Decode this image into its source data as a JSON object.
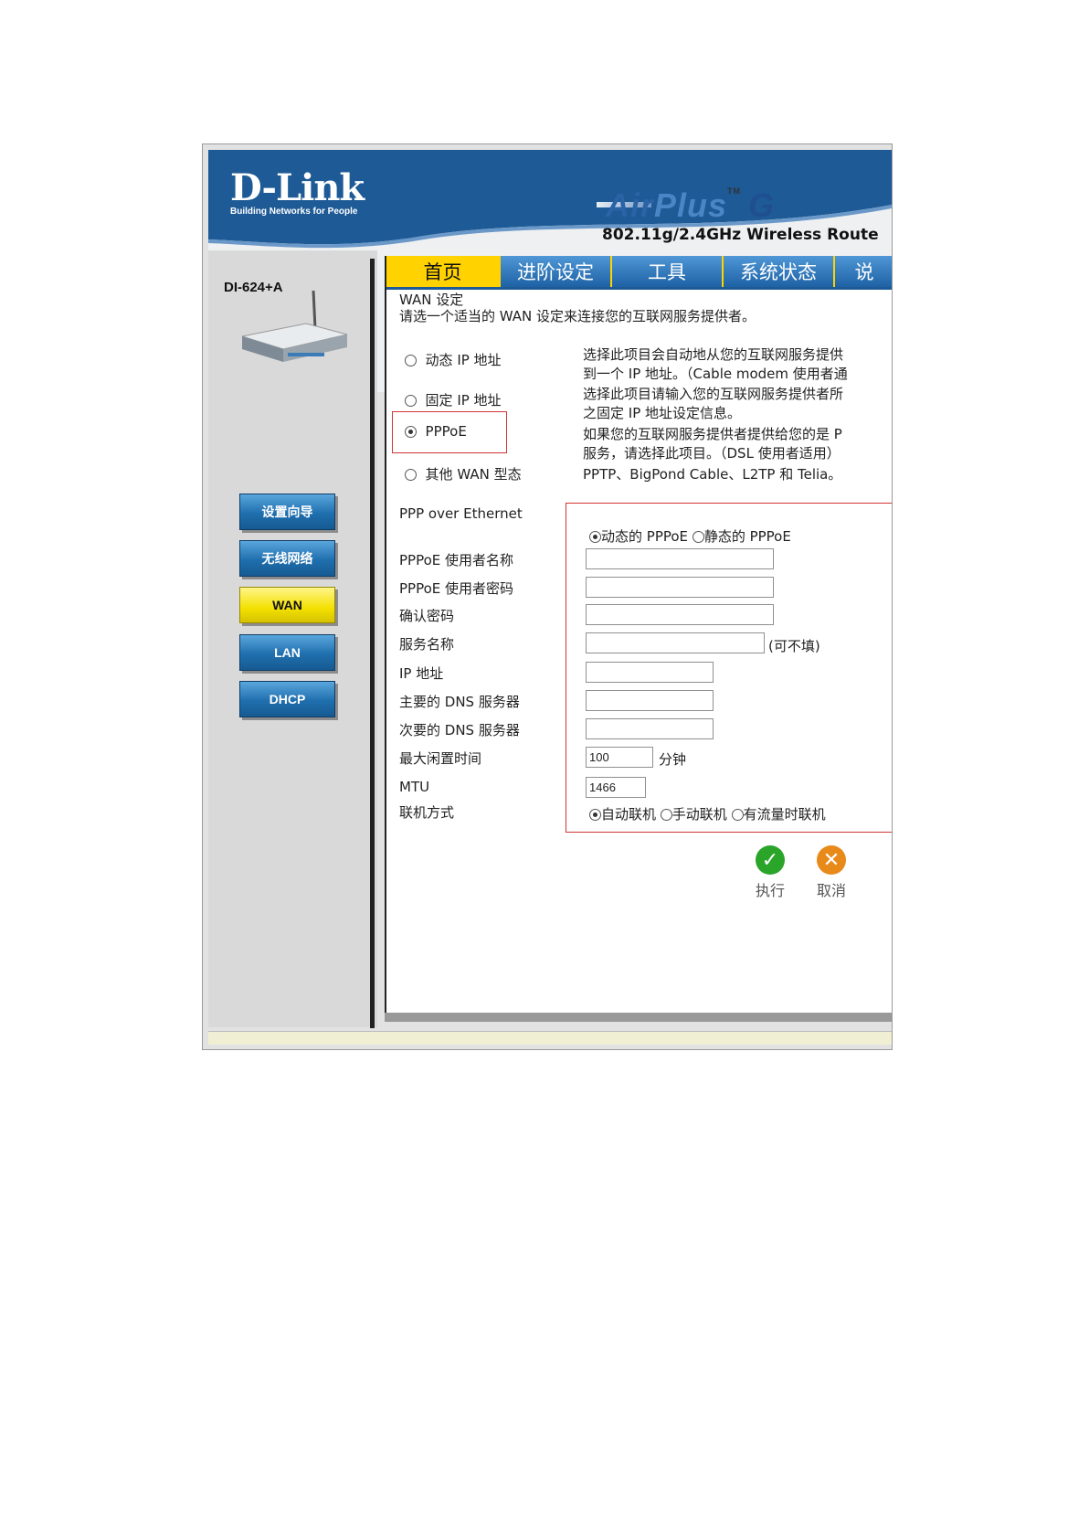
{
  "header": {
    "brand": "D-Link",
    "tagline": "Building Networks for People",
    "product_air": "Air",
    "product_plus": "Plus",
    "product_tm": "TM",
    "product_g": "G",
    "subtitle": "802.11g/2.4GHz Wireless Route"
  },
  "sidebar": {
    "model": "DI-624+A",
    "buttons": [
      {
        "label": "设置向导"
      },
      {
        "label": "无线网络"
      },
      {
        "label": "WAN",
        "active": true
      },
      {
        "label": "LAN"
      },
      {
        "label": "DHCP"
      }
    ]
  },
  "tabs": [
    {
      "label": "首页",
      "active": true
    },
    {
      "label": "进阶设定"
    },
    {
      "label": "工具"
    },
    {
      "label": "系统状态"
    },
    {
      "label": "说"
    }
  ],
  "wan": {
    "section_title": "WAN 设定",
    "intro": "请选一个适当的 WAN 设定来连接您的互联网服务提供者。",
    "options": [
      {
        "label": "动态 IP 地址",
        "desc1": "选择此项目会自动地从您的互联网服务提供",
        "desc2": "到一个 IP 地址。（Cable modem 使用者通"
      },
      {
        "label": "固定 IP 地址",
        "desc1": "选择此项目请输入您的互联网服务提供者所",
        "desc2": "之固定 IP 地址设定信息。"
      },
      {
        "label": "PPPoE",
        "desc1": "如果您的互联网服务提供者提供给您的是 P",
        "desc2": "服务，请选择此项目。（DSL 使用者适用）",
        "selected": true
      },
      {
        "label": "其他 WAN 型态",
        "desc1": "PPTP、BigPond Cable、L2TP 和 Telia。",
        "desc2": ""
      }
    ]
  },
  "ppp": {
    "section_title": "PPP over Ethernet",
    "mode_dynamic": "动态的 PPPoE",
    "mode_static": "静态的 PPPoE",
    "fields": [
      {
        "label": "PPPoE 使用者名称",
        "value": ""
      },
      {
        "label": "PPPoE 使用者密码",
        "value": ""
      },
      {
        "label": "确认密码",
        "value": ""
      },
      {
        "label": "服务名称",
        "value": "",
        "suffix": "(可不填)"
      },
      {
        "label": "IP 地址",
        "value": ""
      },
      {
        "label": "主要的 DNS 服务器",
        "value": ""
      },
      {
        "label": "次要的 DNS 服务器",
        "value": ""
      },
      {
        "label": "最大闲置时间",
        "value": "100",
        "suffix": "分钟"
      },
      {
        "label": "MTU",
        "value": "1466"
      },
      {
        "label": "联机方式"
      }
    ],
    "connect_auto": "自动联机",
    "connect_manual": "手动联机",
    "connect_demand": "有流量时联机"
  },
  "actions": {
    "apply": "执行",
    "cancel": "取消"
  },
  "colors": {
    "header_blue": "#1d5a96",
    "tab_yellow": "#ffd200",
    "highlight_red": "#d23434",
    "apply_green": "#2aa52a",
    "cancel_orange": "#e88a1a"
  }
}
